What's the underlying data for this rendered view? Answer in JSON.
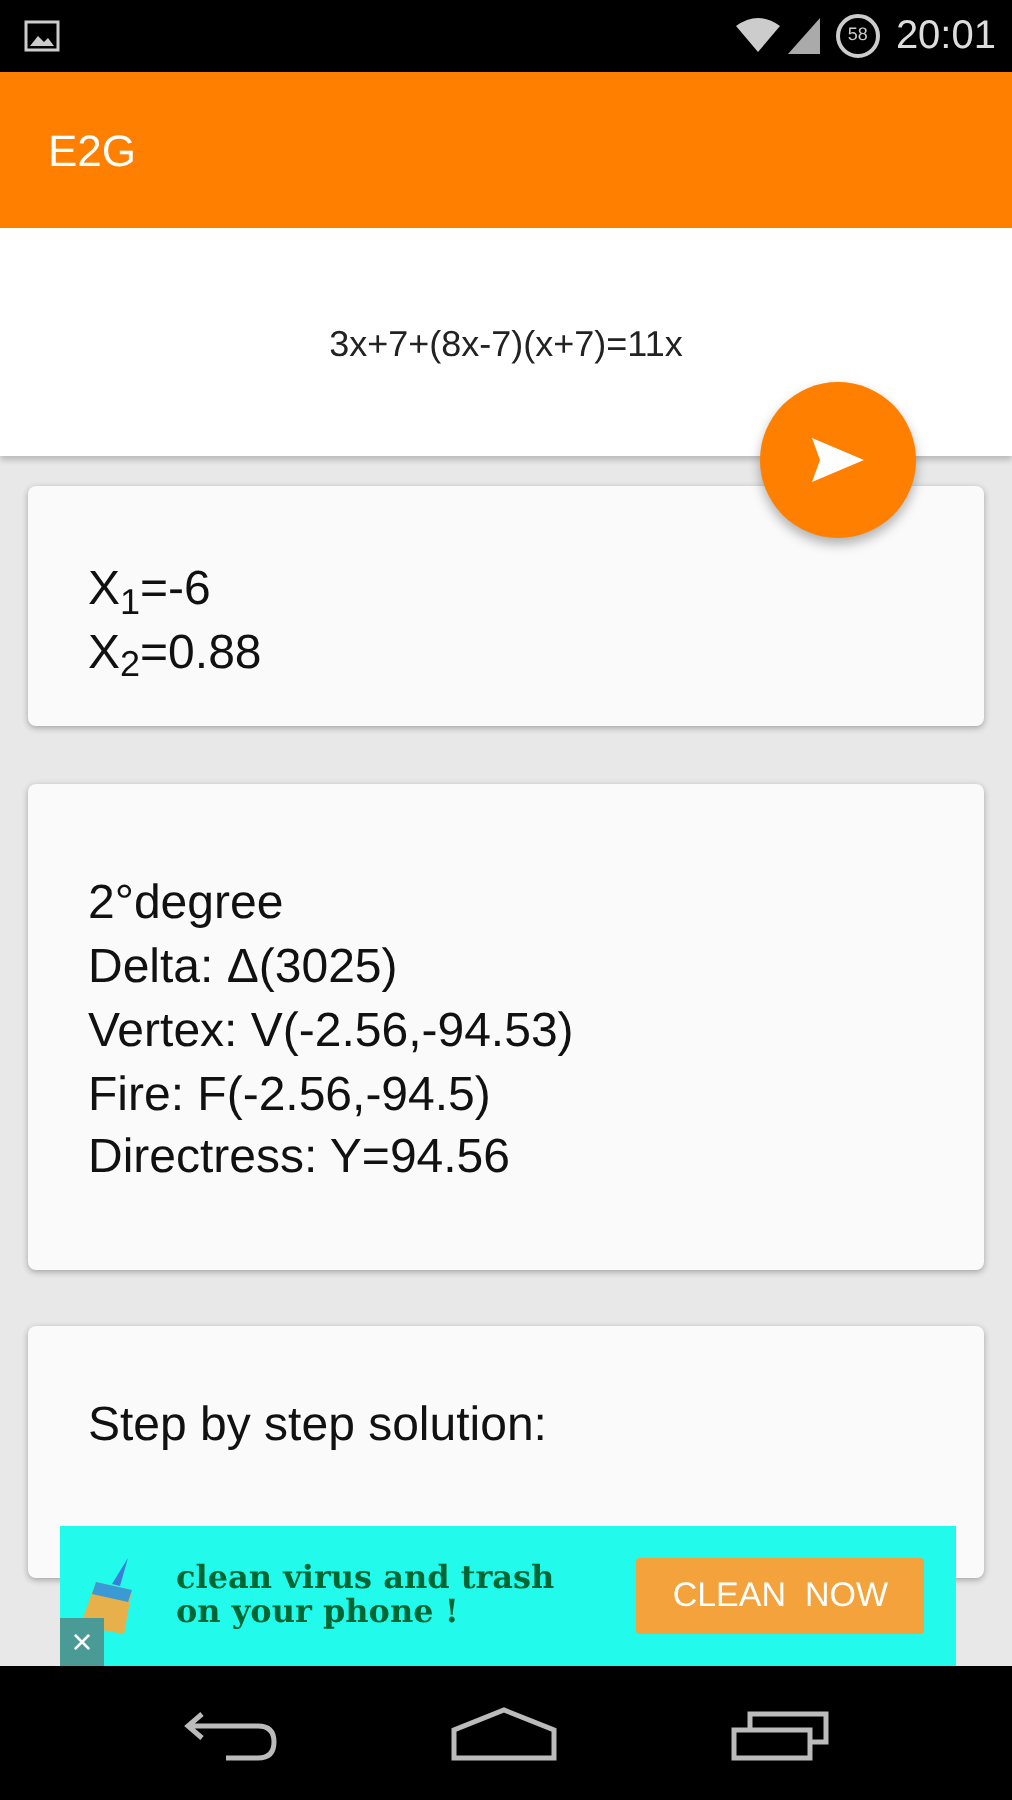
{
  "status_bar": {
    "time": "20:01",
    "battery": "58"
  },
  "app_bar": {
    "title": "E2G"
  },
  "equation": {
    "value": "3x+7+(8x-7)(x+7)=11x"
  },
  "cards": [
    {
      "lines": [
        "X$_{1}$=-6",
        "X$_{2}$=0.88"
      ]
    },
    {
      "lines": [
        "2°degree",
        "Delta: Δ(3025)",
        "Vertex: V(-2.56,-94.53)",
        "Fire: F(-2.56,-94.5)",
        "Directress: Y=94.56"
      ]
    },
    {
      "lines": [
        "Step by step solution:"
      ]
    }
  ],
  "ad": {
    "text": "clean virus and trash on your phone !",
    "button": "CLEAN  NOW",
    "close": "×"
  }
}
